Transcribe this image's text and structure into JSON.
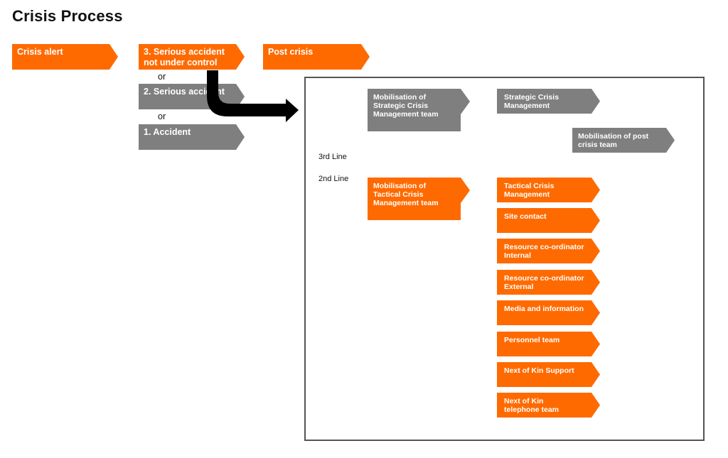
{
  "title": "Crisis Process",
  "colors": {
    "orange": "#ff6a00",
    "gray": "#7f7f7f",
    "frame": "#555555"
  },
  "phases": [
    {
      "label": "Crisis alert"
    },
    {
      "label": "3. Serious accident\nnot under control"
    },
    {
      "label": "Post crisis"
    }
  ],
  "levels": [
    {
      "label": "2. Serious accident"
    },
    {
      "label": "1. Accident"
    }
  ],
  "connector": "or",
  "flow_arrow": "black-curved-arrow-icon",
  "panel": {
    "lines": [
      "3rd Line",
      "2nd Line"
    ],
    "strategic": {
      "mobilisation": "Mobilisation of\nStrategic Crisis\nManagement team",
      "management": "Strategic Crisis\nManagement",
      "post_crisis": "Mobilisation of post\ncrisis team"
    },
    "tactical": {
      "mobilisation": "Mobilisation of\nTactical Crisis\nManagement team",
      "items": [
        "Tactical Crisis\nManagement",
        "Site contact",
        "Resource co-ordinator\nInternal",
        "Resource co-ordinator\nExternal",
        "Media and information",
        "Personnel team",
        "Next of Kin  Support",
        "Next of Kin\ntelephone team"
      ]
    }
  }
}
